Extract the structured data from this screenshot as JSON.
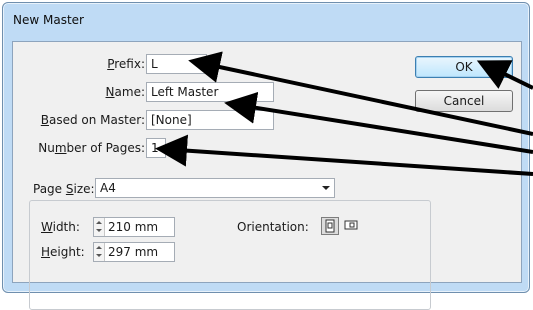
{
  "dialog": {
    "title": "New Master",
    "prefix": {
      "label_pre": "",
      "label_ul": "P",
      "label_post": "refix:",
      "value": "L"
    },
    "name": {
      "label_pre": "",
      "label_ul": "N",
      "label_post": "ame:",
      "value": "Left Master"
    },
    "based_on": {
      "label_pre": "",
      "label_ul": "B",
      "label_post": "ased on Master:",
      "value": "[None]"
    },
    "pages": {
      "label_pre": "Nu",
      "label_ul": "m",
      "label_post": "ber of Pages:",
      "value": "1"
    },
    "page_size": {
      "label_pre": "Page ",
      "label_ul": "S",
      "label_post": "ize:",
      "value": "A4"
    },
    "width": {
      "label_pre": "",
      "label_ul": "W",
      "label_post": "idth:",
      "value": "210 mm"
    },
    "height": {
      "label_pre": "",
      "label_ul": "H",
      "label_post": "eight:",
      "value": "297 mm"
    },
    "orientation_label": "Orientation:",
    "orientation_selected": "portrait",
    "ok_label": "OK",
    "cancel_label": "Cancel"
  },
  "colors": {
    "window_frame": "#bfdbf5",
    "client_bg": "#f0f0f0",
    "annotation_arrow": "#000000"
  },
  "icons": {
    "spin_up": "triangle-up",
    "spin_down": "triangle-down",
    "combo_arrow": "triangle-down",
    "portrait": "portrait-page-icon",
    "landscape": "landscape-page-icon"
  }
}
